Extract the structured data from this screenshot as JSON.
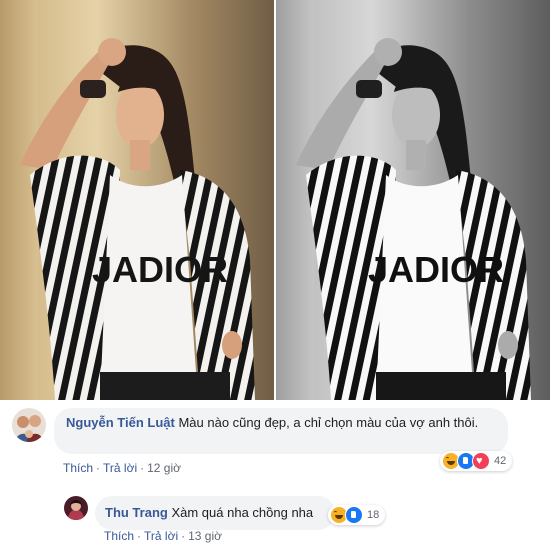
{
  "comments": [
    {
      "author": "Nguyễn Tiến Luật",
      "text": "Màu nào cũng đẹp, a chỉ chọn màu của vợ anh thôi.",
      "like_label": "Thích",
      "reply_label": "Trả lời",
      "time": "12 giờ",
      "reactions": [
        "haha",
        "like",
        "love"
      ],
      "reaction_count": "42"
    },
    {
      "author": "Thu Trang",
      "text": "Xàm quá nha chồng nha",
      "like_label": "Thích",
      "reply_label": "Trả lời",
      "time": "13 giờ",
      "reactions": [
        "haha",
        "like"
      ],
      "reaction_count": "18"
    }
  ],
  "photo": {
    "shirt_text": "JADIOR"
  },
  "colors": {
    "author_link": "#385898",
    "bubble_bg": "#f2f3f5",
    "meta_text": "#606770",
    "like_blue": "#1877f2",
    "love_red": "#f33e58",
    "haha_yellow": "#f7b125"
  }
}
